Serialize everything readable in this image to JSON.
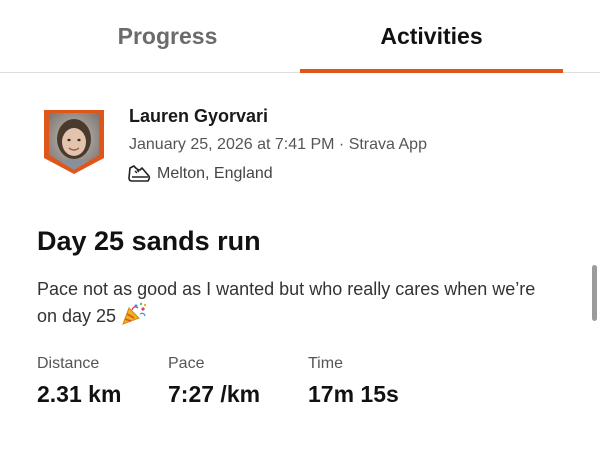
{
  "tabs": [
    {
      "label": "Progress",
      "active": false
    },
    {
      "label": "Activities",
      "active": true
    }
  ],
  "accent_color": "#e0561a",
  "activity": {
    "athlete_name": "Lauren Gyorvari",
    "meta": "January 25, 2026 at 7:41 PM · Strava App",
    "location": "Melton, England",
    "location_icon": "running-shoe-icon",
    "title": "Day 25 sands run",
    "description": "Pace not as good as I wanted but who really cares when we’re on day 25",
    "description_emoji": "party-popper-icon",
    "stats": [
      {
        "label": "Distance",
        "value": "2.31 km"
      },
      {
        "label": "Pace",
        "value": "7:27 /km"
      },
      {
        "label": "Time",
        "value": "17m 15s"
      }
    ]
  }
}
